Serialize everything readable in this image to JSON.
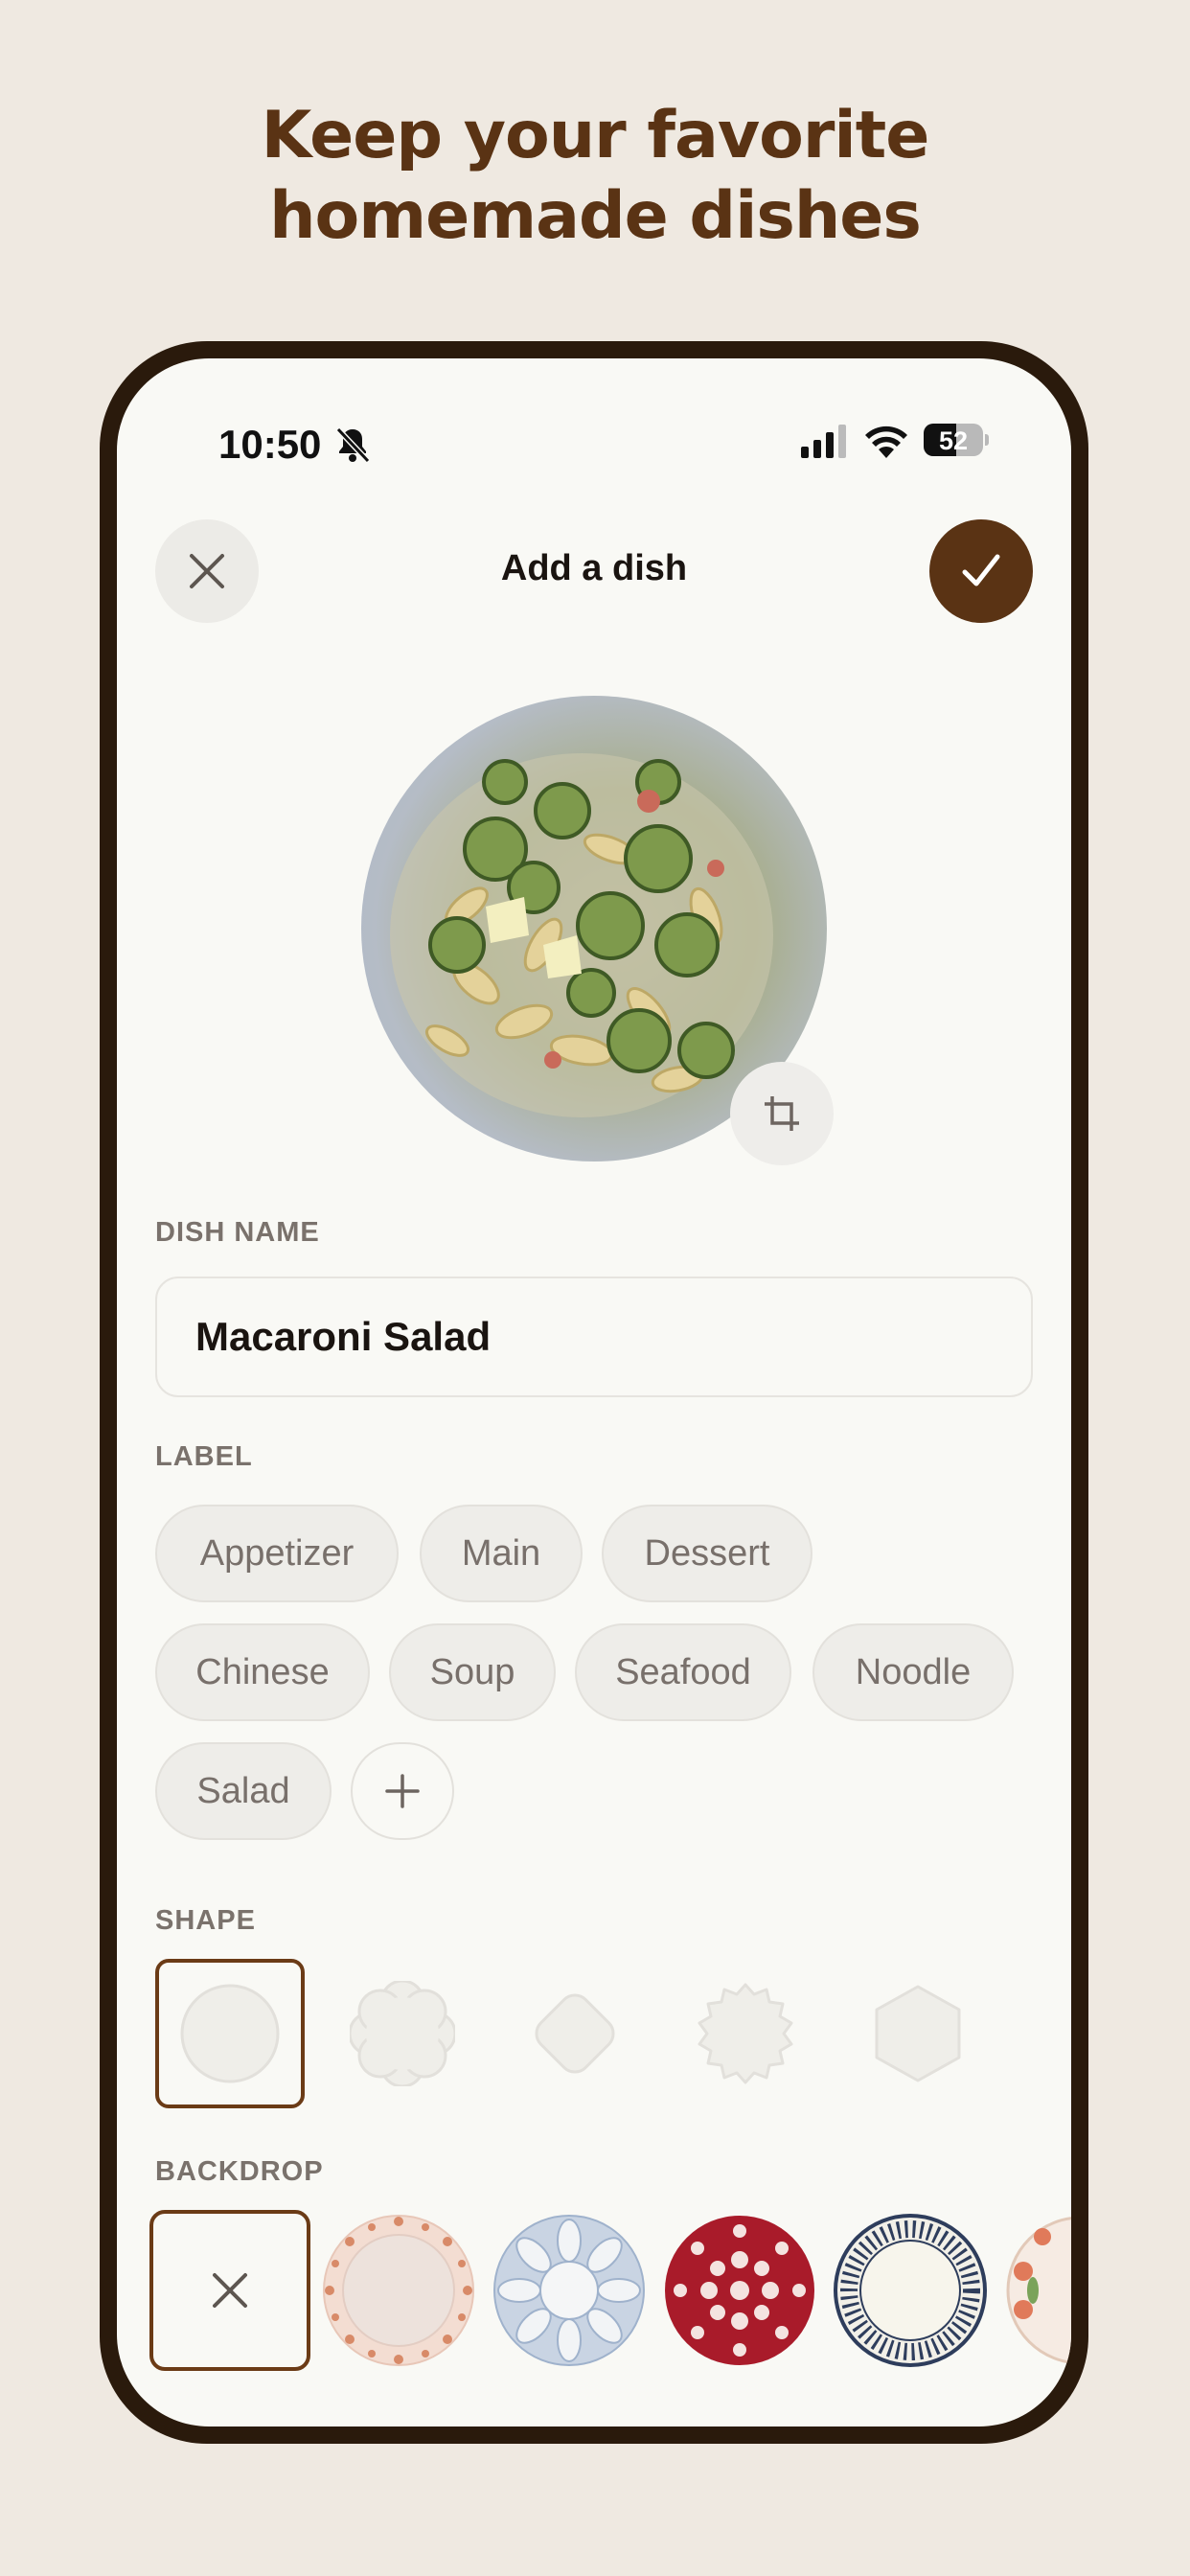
{
  "headline": {
    "line1": "Keep your favorite",
    "line2": "homemade dishes"
  },
  "status_bar": {
    "time": "10:50",
    "battery": "52"
  },
  "nav": {
    "title": "Add a dish",
    "close_icon": "close-icon",
    "confirm_icon": "checkmark-icon"
  },
  "photo": {
    "alt": "Macaroni salad with cucumbers",
    "crop_icon": "crop-icon"
  },
  "dish_name": {
    "label": "DISH NAME",
    "value": "Macaroni Salad"
  },
  "label_section": {
    "label": "LABEL",
    "chips": [
      "Appetizer",
      "Main",
      "Dessert",
      "Chinese",
      "Soup",
      "Seafood",
      "Noodle",
      "Salad"
    ],
    "add_icon": "plus-icon"
  },
  "shape_section": {
    "label": "SHAPE",
    "shapes": [
      "circle",
      "flower",
      "rounded-diamond",
      "scalloped",
      "hexagon"
    ],
    "selected": "circle"
  },
  "backdrop_section": {
    "label": "BACKDROP",
    "options": [
      "none",
      "pink-dotted-plate",
      "blue-floral-plate",
      "red-dot-plate",
      "striped-blue-plate",
      "floral-plate"
    ],
    "selected": "none"
  },
  "colors": {
    "brand": "#5a3314",
    "background": "#efe9e1",
    "screen": "#f9f9f5"
  }
}
